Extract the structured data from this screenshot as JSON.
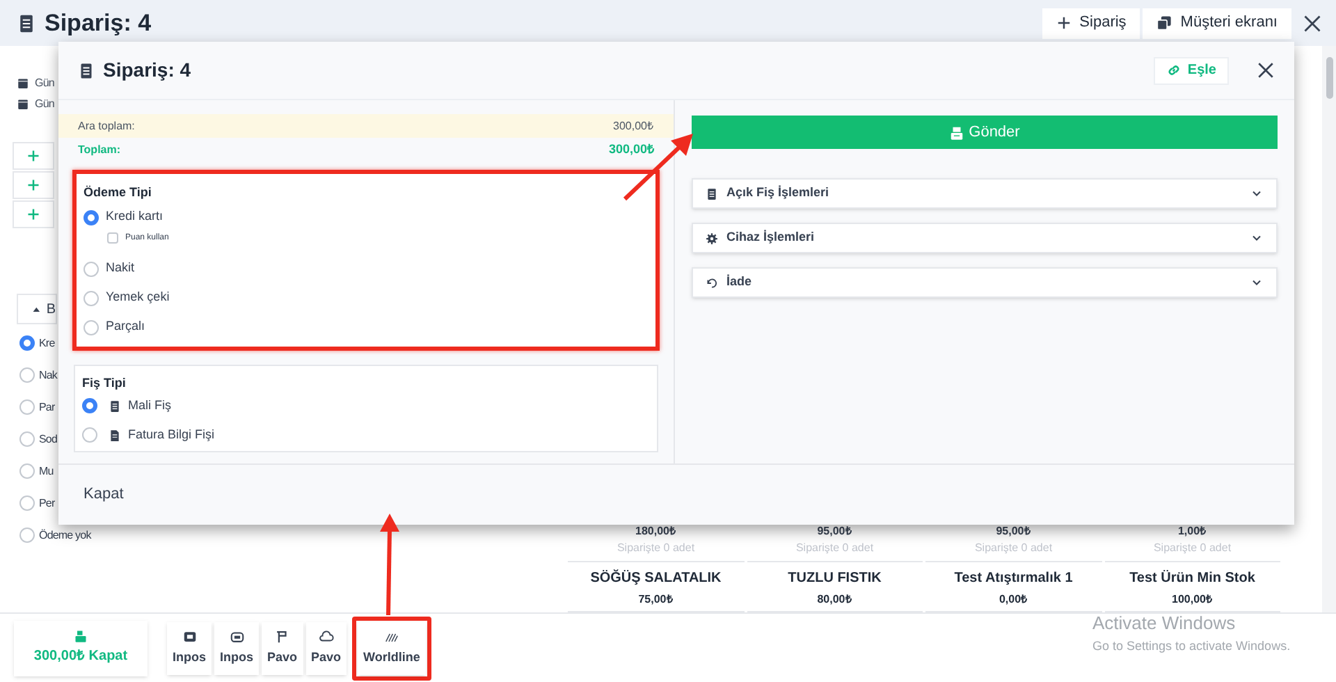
{
  "app_header": {
    "title": "Sipariş: 4",
    "buttons": [
      "Sipariş",
      "Müşteri ekranı"
    ]
  },
  "date_filters": [
    "Gün",
    "Gün"
  ],
  "partial_button": "B",
  "payment_list": [
    {
      "label": "Kre",
      "selected": true
    },
    {
      "label": "Nak",
      "selected": false
    },
    {
      "label": "Par",
      "selected": false
    },
    {
      "label": "Sod",
      "selected": false
    },
    {
      "label": "Mu",
      "selected": false
    },
    {
      "label": "Per",
      "selected": false
    },
    {
      "label": "Ödeme yok",
      "selected": false
    }
  ],
  "tiles_partial": [
    {
      "price": "180,00₺",
      "stock": "Siparişte 0 adet"
    },
    {
      "price": "95,00₺",
      "stock": "Siparişte 0 adet"
    },
    {
      "price": "95,00₺",
      "stock": "Siparişte 0 adet"
    },
    {
      "price": "1,00₺",
      "stock": "Siparişte 0 adet"
    }
  ],
  "tiles": [
    {
      "name": "SÖĞÜŞ SALATALIK",
      "price": "75,00₺"
    },
    {
      "name": "TUZLU FISTIK",
      "price": "80,00₺"
    },
    {
      "name": "Test Atıştırmalık 1",
      "price": "0,00₺"
    },
    {
      "name": "Test Ürün Min Stok",
      "price": "100,00₺"
    }
  ],
  "bottom_bar": {
    "checkout": "300,00₺ Kapat",
    "devices": [
      "Inpos",
      "Inpos",
      "Pavo",
      "Pavo",
      "Worldline"
    ]
  },
  "modal": {
    "title": "Sipariş: 4",
    "pair_button": "Eşle",
    "subtotal": {
      "label": "Ara toplam:",
      "value": "300,00₺"
    },
    "total": {
      "label": "Toplam:",
      "value": "300,00₺"
    },
    "payment_type": {
      "title": "Ödeme Tipi",
      "options": [
        {
          "label": "Kredi kartı",
          "selected": true
        },
        {
          "label": "Nakit",
          "selected": false
        },
        {
          "label": "Yemek çeki",
          "selected": false
        },
        {
          "label": "Parçalı",
          "selected": false
        }
      ],
      "points": {
        "label": "Puan kullan",
        "checked": false
      }
    },
    "receipt_type": {
      "title": "Fiş Tipi",
      "options": [
        {
          "label": "Mali Fiş",
          "selected": true
        },
        {
          "label": "Fatura Bilgi Fişi",
          "selected": false
        }
      ]
    },
    "send_button": "Gönder",
    "sections": [
      {
        "label": "Açık Fiş İşlemleri",
        "expanded": false
      },
      {
        "label": "Cihaz İşlemleri",
        "expanded": false
      },
      {
        "label": "İade",
        "expanded": false
      }
    ],
    "close_button": "Kapat"
  },
  "os_notice": {
    "title": "Activate Windows",
    "text": "Go to Settings to activate Windows."
  }
}
